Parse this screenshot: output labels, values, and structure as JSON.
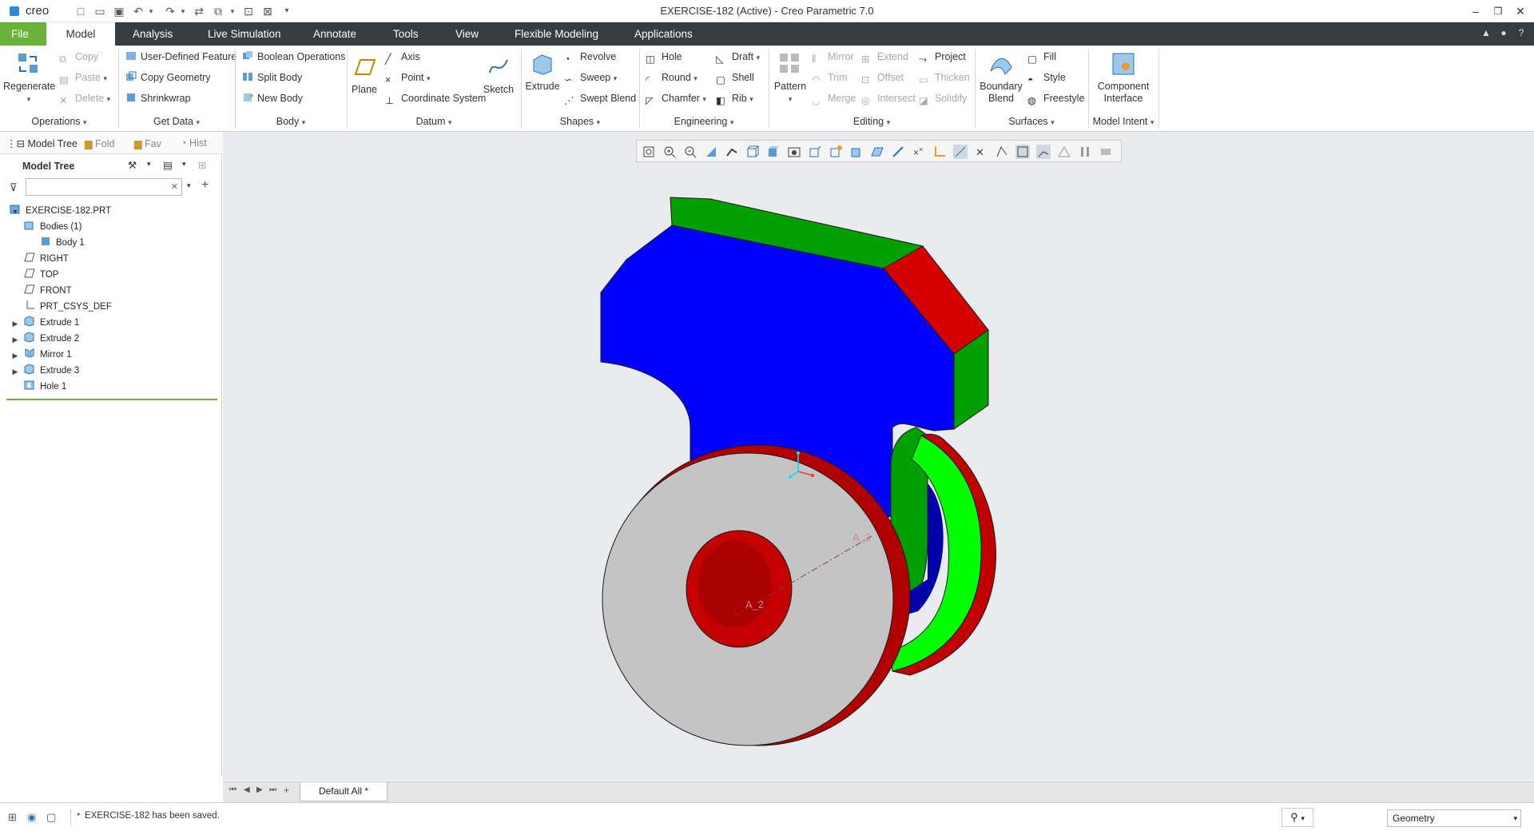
{
  "app": {
    "title": "EXERCISE-182 (Active) - Creo Parametric 7.0",
    "logo": "creo"
  },
  "tabs": [
    "File",
    "Model",
    "Analysis",
    "Live Simulation",
    "Annotate",
    "Tools",
    "View",
    "Flexible Modeling",
    "Applications"
  ],
  "ribbon": {
    "operations": {
      "regenerate": "Regenerate",
      "copy": "Copy",
      "paste": "Paste",
      "delete": "Delete",
      "group": "Operations"
    },
    "get_data": {
      "udf": "User-Defined Feature",
      "copy_geometry": "Copy Geometry",
      "shrinkwrap": "Shrinkwrap",
      "group": "Get Data"
    },
    "body": {
      "boolean": "Boolean Operations",
      "split": "Split Body",
      "new": "New Body",
      "group": "Body"
    },
    "datum": {
      "plane": "Plane",
      "axis": "Axis",
      "point": "Point",
      "csys": "Coordinate System",
      "sketch": "Sketch",
      "group": "Datum"
    },
    "shapes": {
      "extrude": "Extrude",
      "revolve": "Revolve",
      "sweep": "Sweep",
      "swept_blend": "Swept Blend",
      "group": "Shapes"
    },
    "engineering": {
      "hole": "Hole",
      "round": "Round",
      "chamfer": "Chamfer",
      "draft": "Draft",
      "shell": "Shell",
      "rib": "Rib",
      "group": "Engineering"
    },
    "editing": {
      "pattern": "Pattern",
      "mirror": "Mirror",
      "trim": "Trim",
      "merge": "Merge",
      "extend": "Extend",
      "offset": "Offset",
      "intersect": "Intersect",
      "project": "Project",
      "thicken": "Thicken",
      "solidify": "Solidify",
      "group": "Editing"
    },
    "surfaces": {
      "boundary_blend": "Boundary Blend",
      "fill": "Fill",
      "style": "Style",
      "freestyle": "Freestyle",
      "group": "Surfaces"
    },
    "model_intent": {
      "component_interface": "Component Interface",
      "group": "Model Intent"
    }
  },
  "panel_tabs": [
    "Model Tree",
    "Fold",
    "Fav",
    "Hist"
  ],
  "model_tree": {
    "header": "Model Tree",
    "search_placeholder": "",
    "items": [
      {
        "label": "EXERCISE-182.PRT"
      },
      {
        "label": "Bodies (1)"
      },
      {
        "label": "Body 1"
      },
      {
        "label": "RIGHT"
      },
      {
        "label": "TOP"
      },
      {
        "label": "FRONT"
      },
      {
        "label": "PRT_CSYS_DEF"
      },
      {
        "label": "Extrude 1"
      },
      {
        "label": "Extrude 2"
      },
      {
        "label": "Mirror 1"
      },
      {
        "label": "Extrude 3"
      },
      {
        "label": "Hole 1"
      }
    ]
  },
  "viewport": {
    "axis_label_a2": "A_2",
    "axis_label_a3": "A_3"
  },
  "bottom": {
    "layer_tab": "Default All *"
  },
  "status": {
    "message": "EXERCISE-182 has been saved.",
    "filter": "Geometry"
  },
  "colors": {
    "file_tab": "#69b33a",
    "tabbar": "#363d42",
    "blue": "#0000ff",
    "green": "#00a000",
    "red": "#d40000",
    "gray_face": "#c4c4c4"
  }
}
